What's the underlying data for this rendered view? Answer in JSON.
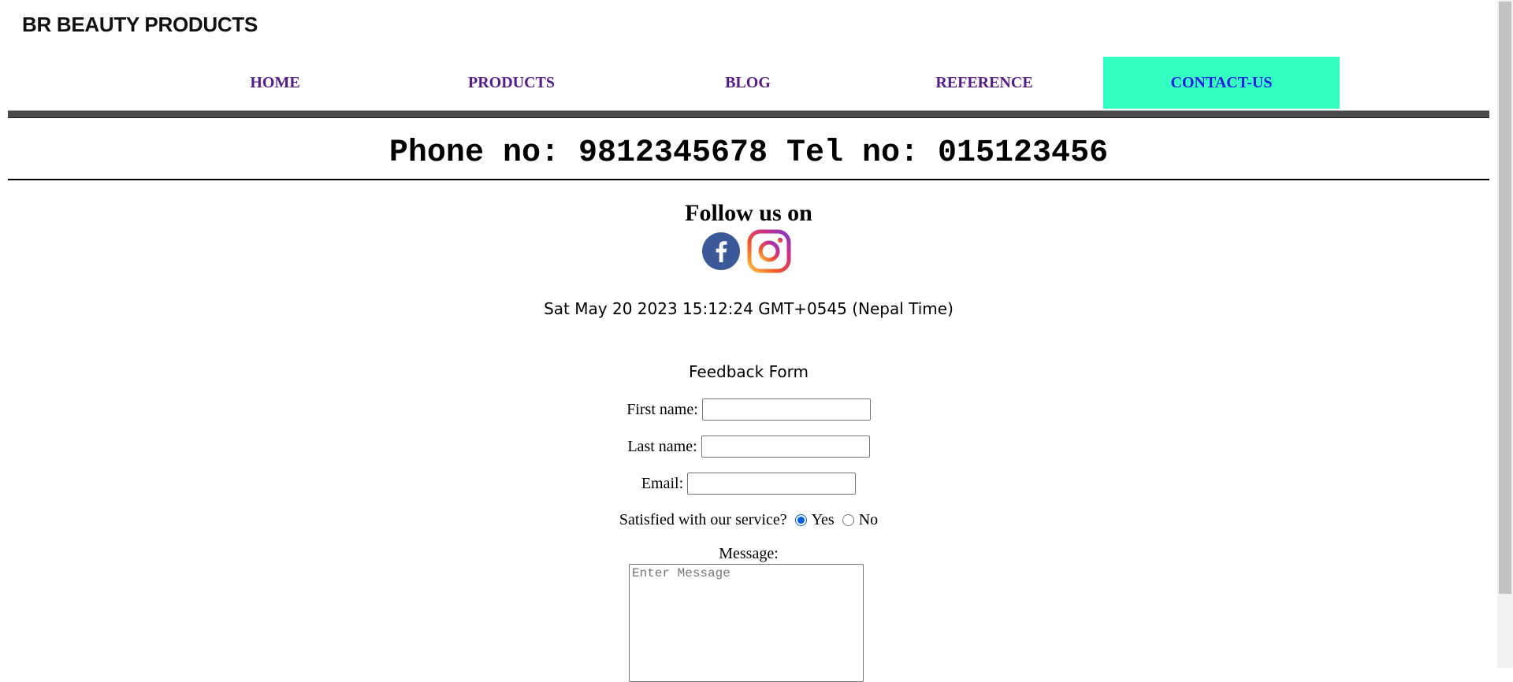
{
  "brand": "BR BEAUTY PRODUCTS",
  "nav": {
    "items": [
      {
        "label": "HOME"
      },
      {
        "label": "PRODUCTS"
      },
      {
        "label": "BLOG"
      },
      {
        "label": "REFERENCE"
      },
      {
        "label": "CONTACT-US"
      }
    ],
    "active": "CONTACT-US",
    "active_color": "#33ffc0"
  },
  "contact": {
    "phone_line": "Phone no: 9812345678 Tel no: 015123456"
  },
  "social": {
    "heading": "Follow us on",
    "icons": [
      "facebook-icon",
      "instagram-icon"
    ]
  },
  "datetime": "Sat May 20 2023 15:12:24 GMT+0545 (Nepal Time)",
  "form": {
    "title": "Feedback Form",
    "first_name_label": "First name:",
    "first_name_value": "",
    "last_name_label": "Last name:",
    "last_name_value": "",
    "email_label": "Email:",
    "email_value": "",
    "satisfied_label": "Satisfied with our service?",
    "yes_label": "Yes",
    "no_label": "No",
    "selected": "Yes",
    "message_label": "Message:",
    "message_placeholder": "Enter Message"
  }
}
